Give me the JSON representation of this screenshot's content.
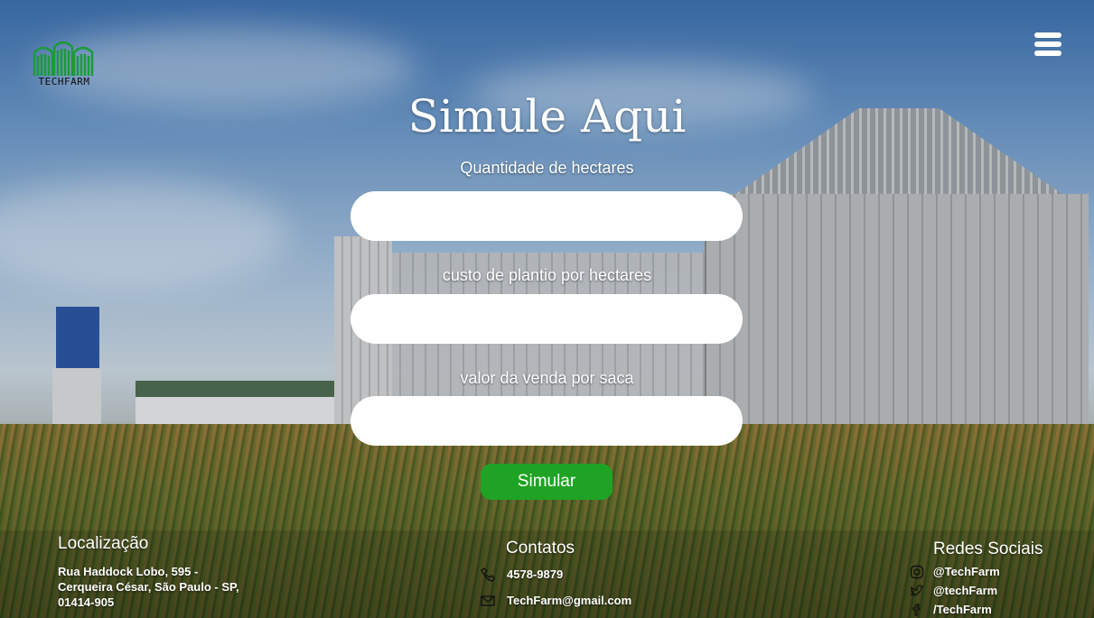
{
  "brand": {
    "logo_text": "TECHFARM"
  },
  "header": {
    "menu_icon": "hamburger-menu-icon"
  },
  "form": {
    "title": "Simule Aqui",
    "fields": [
      {
        "label": "Quantidade de hectares",
        "value": "",
        "placeholder": ""
      },
      {
        "label": "custo de plantio por hectares",
        "value": "",
        "placeholder": ""
      },
      {
        "label": "valor da venda por saca",
        "value": "",
        "placeholder": ""
      }
    ],
    "submit_label": "Simular",
    "submit_color": "#1fa324"
  },
  "footer": {
    "location": {
      "heading": "Localização",
      "address_line1": "Rua Haddock Lobo, 595 -",
      "address_line2": "Cerqueira César, São Paulo - SP,",
      "address_line3": "01414-905"
    },
    "contacts": {
      "heading": "Contatos",
      "phone": "4578-9879",
      "email": "TechFarm@gmail.com",
      "phone_icon": "phone-icon",
      "email_icon": "mail-icon"
    },
    "social": {
      "heading": "Redes Sociais",
      "items": [
        {
          "label": "@TechFarm",
          "icon": "instagram-icon"
        },
        {
          "label": "@techFarm",
          "icon": "twitter-icon"
        },
        {
          "label": "/TechFarm",
          "icon": "facebook-icon"
        }
      ]
    }
  }
}
